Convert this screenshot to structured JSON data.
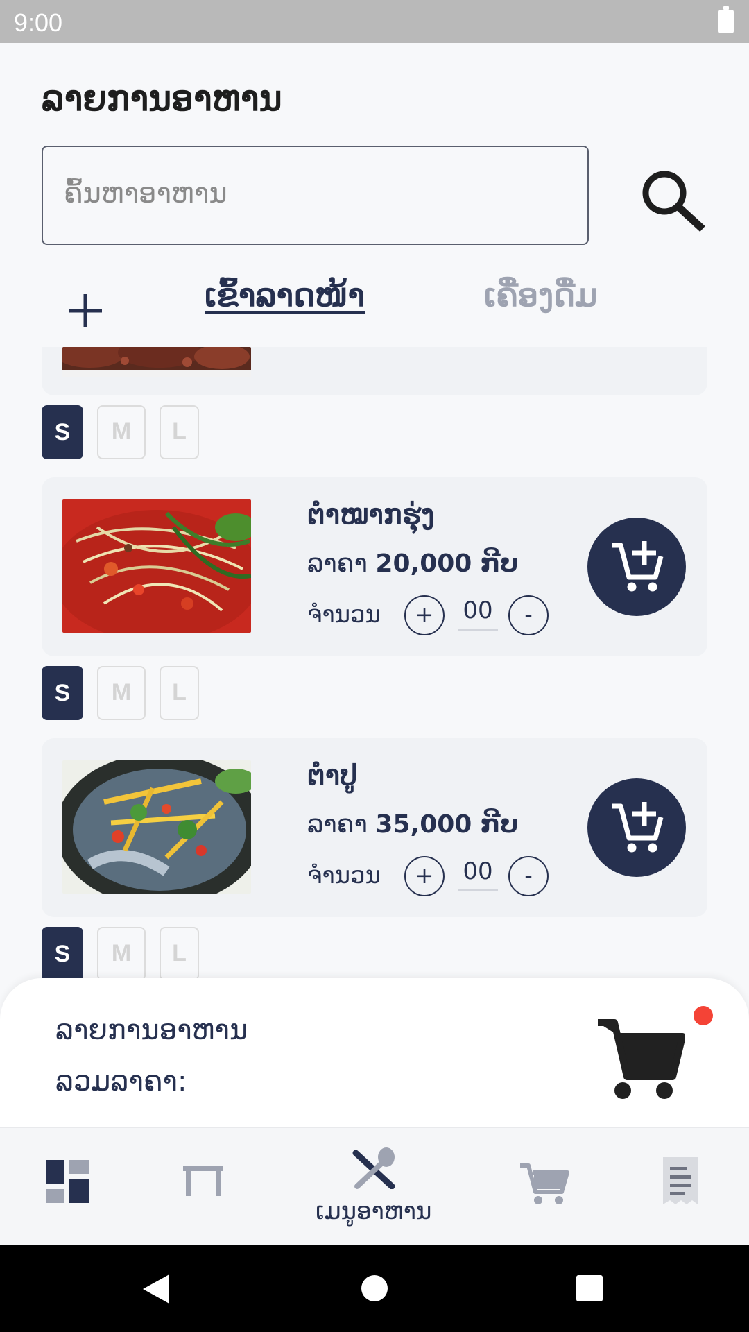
{
  "status_bar": {
    "time": "9:00"
  },
  "header": {
    "title": "ລາຍການອາຫານ"
  },
  "search": {
    "placeholder": "ຄົ້ນຫາອາຫານ"
  },
  "tabs": [
    {
      "label": "ເຂົ້າລາດໜ້າ",
      "active": true
    },
    {
      "label": "ເຄື່ອງດື່ມ",
      "active": false
    }
  ],
  "items": [
    {
      "name": "ຕໍາໝາກຮຸ່ງ",
      "price_label": "ລາຄາ",
      "price_value": "20,000 ກີບ",
      "qty_label": "ຈໍານວນ",
      "qty": "00",
      "plus": "+",
      "minus": "-"
    },
    {
      "name": "ຕໍາປູ",
      "price_label": "ລາຄາ",
      "price_value": "35,000 ກີບ",
      "qty_label": "ຈໍານວນ",
      "qty": "00",
      "plus": "+",
      "minus": "-"
    }
  ],
  "sizes": [
    "S",
    "M",
    "L"
  ],
  "cart_summary": {
    "items_label": "ລາຍການອາຫານ",
    "total_label": "ລວມລາຄາ:"
  },
  "bottom_nav": {
    "active_label": "ເມນູອາຫານ"
  },
  "colors": {
    "primary": "#26304f",
    "badge": "#f44336",
    "background": "#f7f8fa",
    "card": "#f0f2f5"
  }
}
